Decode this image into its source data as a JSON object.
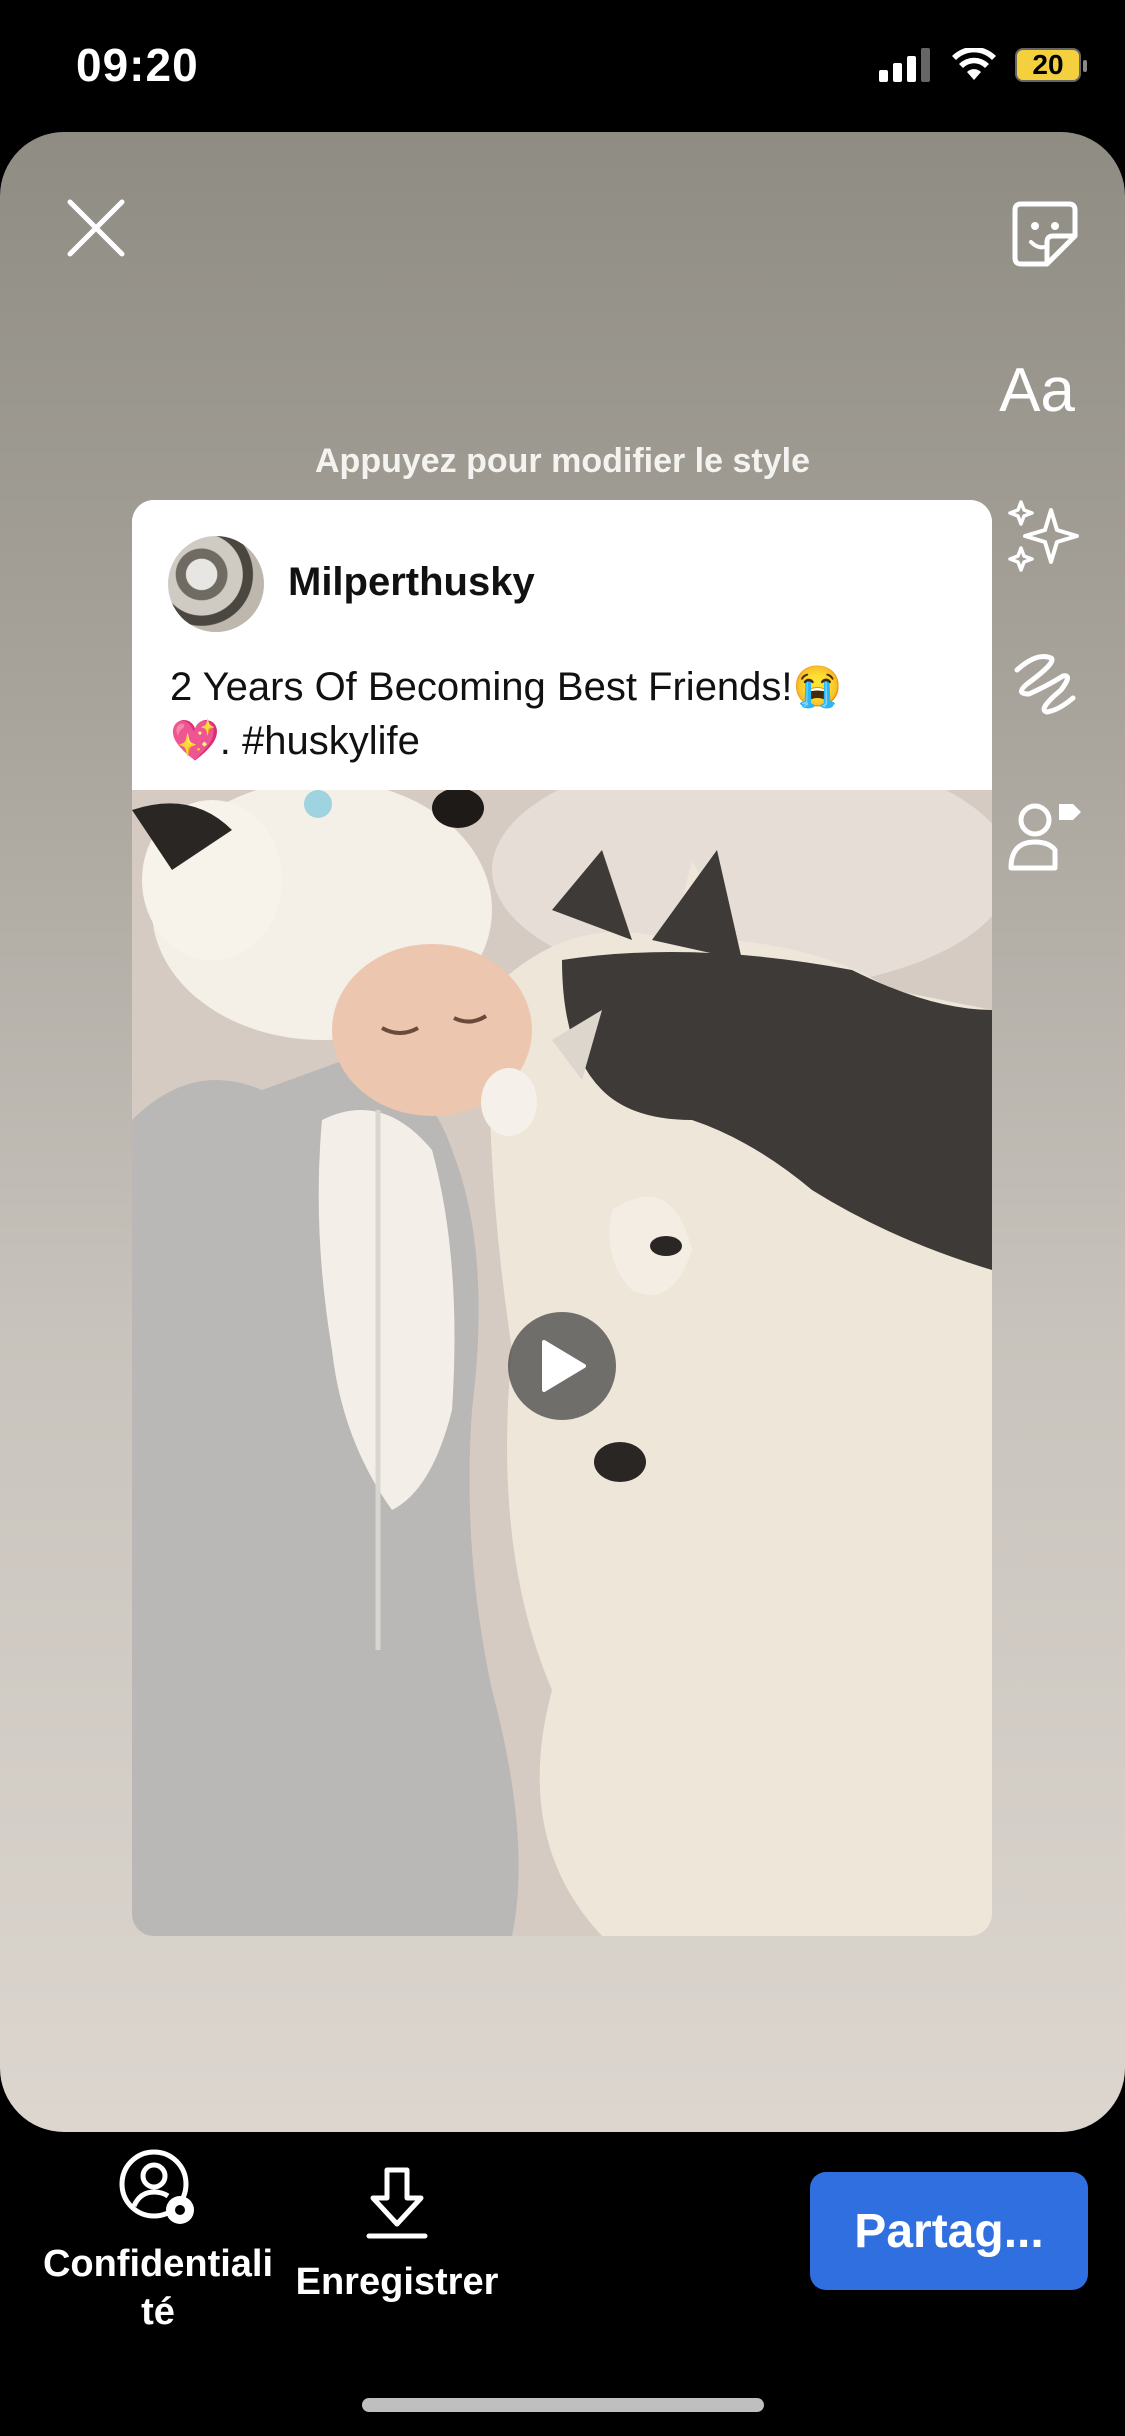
{
  "status_bar": {
    "time": "09:20",
    "battery": "20"
  },
  "editor": {
    "hint": "Appuyez pour modifier le style",
    "text_tool_label": "Aa",
    "icons": [
      "close-icon",
      "sticker-icon",
      "text-icon",
      "effects-icon",
      "draw-icon",
      "tag-people-icon"
    ]
  },
  "post": {
    "username": "Milperthusky",
    "caption_line1": "2 Years Of Becoming Best Friends!😭",
    "caption_line2": "💖. #huskylife",
    "media": "video"
  },
  "bottom_bar": {
    "privacy_label_line1": "Confidentiali",
    "privacy_label_line2": "té",
    "save_label": "Enregistrer",
    "share_label": "Partag..."
  },
  "colors": {
    "accent": "#2f6fe0",
    "battery": "#f4d03f"
  }
}
